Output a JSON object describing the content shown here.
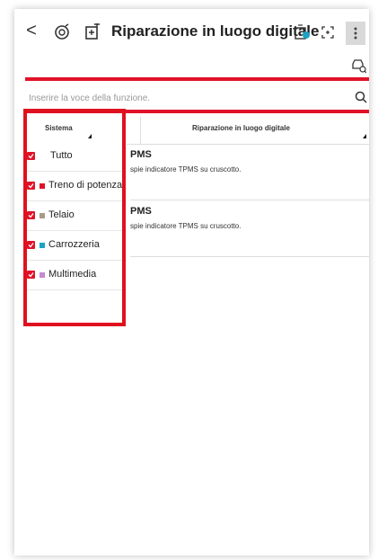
{
  "app": {
    "title": "Riparazione in luogo digitale",
    "back_glyph": "<",
    "icons": [
      "back-icon",
      "remote-diagnosis-icon",
      "add-document-icon",
      "device-connection-icon",
      "fullscreen-icon",
      "more-vertical-icon",
      "vehicle-search-icon"
    ]
  },
  "search": {
    "placeholder": "Inserire la voce della funzione."
  },
  "table": {
    "col_system": "Sistema",
    "col_repair": "Riparazione in luogo digitale",
    "rows": [
      {
        "title": "PMS",
        "desc": "spie indicatore TPMS su cruscotto."
      },
      {
        "title": "PMS",
        "desc": "spie indicatore TPMS su cruscotto."
      }
    ]
  },
  "filter": {
    "items": [
      {
        "label": "Tutto",
        "color": ""
      },
      {
        "label": "Treno di potenza",
        "color": "#e0122a"
      },
      {
        "label": "Telaio",
        "color": "#a89a86"
      },
      {
        "label": "Carrozzeria",
        "color": "#1fa3c4"
      },
      {
        "label": "Multimedia",
        "color": "#c58ad0"
      }
    ]
  },
  "colors": {
    "accent": "#e0122a",
    "highlight": "#e0111f"
  }
}
